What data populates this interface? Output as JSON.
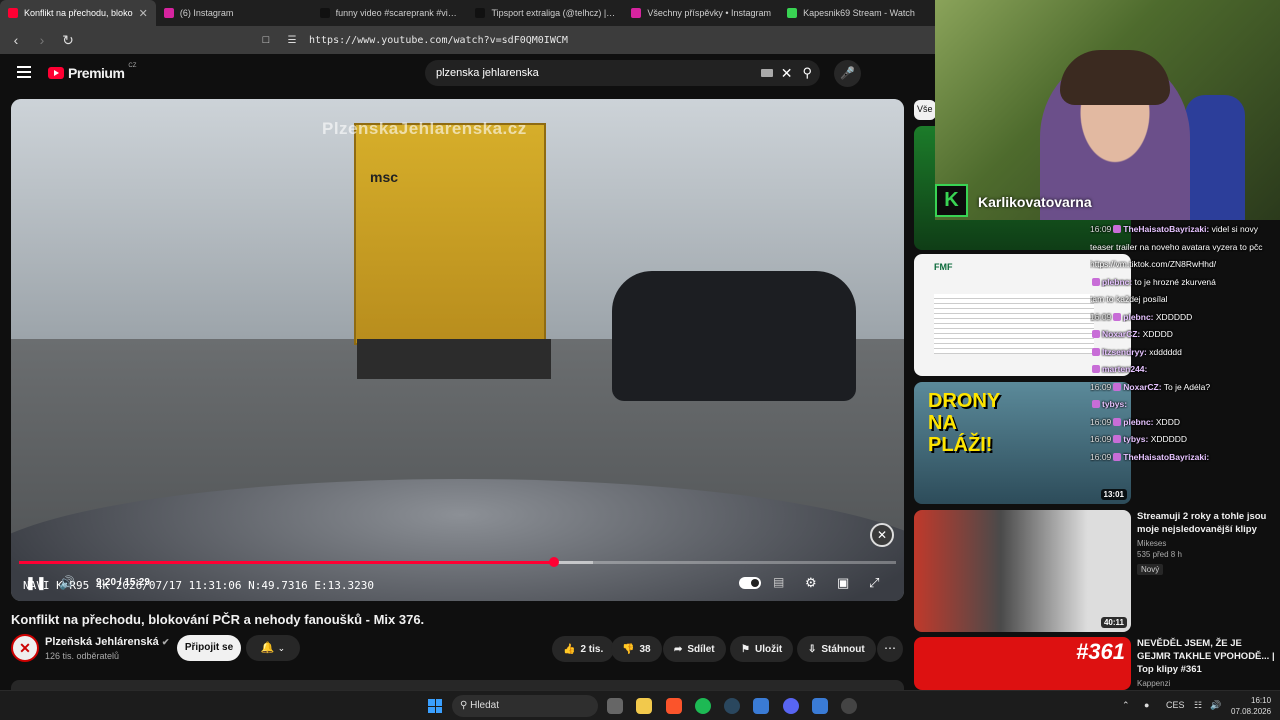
{
  "tabs": [
    {
      "label": "Konflikt na přechodu, bloko",
      "color": "#ff0033",
      "active": true
    },
    {
      "label": "(6) Instagram",
      "color": "#d6249f"
    },
    {
      "label": "funny video #scareprank #viral #fa",
      "color": "#111111"
    },
    {
      "label": "Tipsport extraliga (@telhcz) | TikTok",
      "color": "#111111"
    },
    {
      "label": "Všechny příspěvky • Instagram",
      "color": "#d6249f"
    },
    {
      "label": "Kapesnik69 Stream - Watch",
      "color": "#39d353"
    }
  ],
  "address": {
    "url": "https://www.youtube.com/watch?v=sdF0QM0IWCM"
  },
  "youtube": {
    "logo": "Premium",
    "logo_sup": "CZ",
    "search_query": "plzenska jehlarenska"
  },
  "video": {
    "watermark": "PlzenskaJehlarenska.cz",
    "overlay": "NAVI  K  R95 4K  2026/07/17  11:31:06  N:49.7316  E:13.3230",
    "time": "9:20 / 15:29",
    "progress": 0.61,
    "buffered": 0.655,
    "title": "Konflikt na přechodu, blokování PČR a nehody fanoušků - Mix 376."
  },
  "channel": {
    "name": "Plzeňská Jehlárenská",
    "subs": "126 tis. odběratelů",
    "subscribe": "Připojit se"
  },
  "actions": {
    "likes": "2 tis.",
    "dislikes": "38",
    "share": "Sdílet",
    "save": "Uložit",
    "download": "Stáhnout"
  },
  "sidebar": {
    "chip": "Vše",
    "recs": [
      {
        "duration": "13:01",
        "thumb_text": "DRONY NA PLÁŽI!"
      },
      {
        "title": "Streamuji 2 roky a tohle jsou moje nejsledovanější klipy",
        "channel": "Mikeses",
        "info": "535  před 8 h",
        "badge": "Nový",
        "duration": "40:11"
      },
      {
        "title": "NEVĚDĚL JSEM, ŽE JE GEJMR TAKHLE VPOHODĚ... | Top klipy #361",
        "channel": "Kappenzi",
        "thumb_text": "#361"
      }
    ]
  },
  "stream": {
    "name": "Karlikovatovarna",
    "logo": "K"
  },
  "chat": [
    {
      "ts": "16:09",
      "user": "TheHaisatoBayrizaki:",
      "msg": "videl si novy"
    },
    {
      "ts": "",
      "user": "",
      "msg": "teaser trailer na noveho avatara vyzera to pčc"
    },
    {
      "ts": "",
      "user": "",
      "msg": "https://vm.tiktok.com/ZN8RwHhd/"
    },
    {
      "ts": "",
      "user": "plebnc:",
      "msg": "to je hrozné zkurvená"
    },
    {
      "ts": "",
      "user": "",
      "msg": "tam to každej posílal"
    },
    {
      "ts": "16:09",
      "user": "plebnc:",
      "msg": "XDDDDD"
    },
    {
      "ts": "",
      "user": "NoxarCZ:",
      "msg": "XDDDD"
    },
    {
      "ts": "",
      "user": "Itzsendryy:",
      "msg": "xdddddd"
    },
    {
      "ts": "",
      "user": "marten244:",
      "msg": ""
    },
    {
      "ts": "16:09",
      "user": "NoxarCZ:",
      "msg": "To je Adéla?"
    },
    {
      "ts": "",
      "user": "tybys:",
      "msg": ""
    },
    {
      "ts": "16:09",
      "user": "plebnc:",
      "msg": "XDDD"
    },
    {
      "ts": "16:09",
      "user": "tybys:",
      "msg": "XDDDDD"
    },
    {
      "ts": "16:09",
      "user": "TheHaisatoBayrizaki:",
      "msg": ""
    }
  ],
  "taskbar": {
    "search": "Hledat",
    "lang": "CES",
    "time": "16:10",
    "date": "07.08.2026"
  }
}
